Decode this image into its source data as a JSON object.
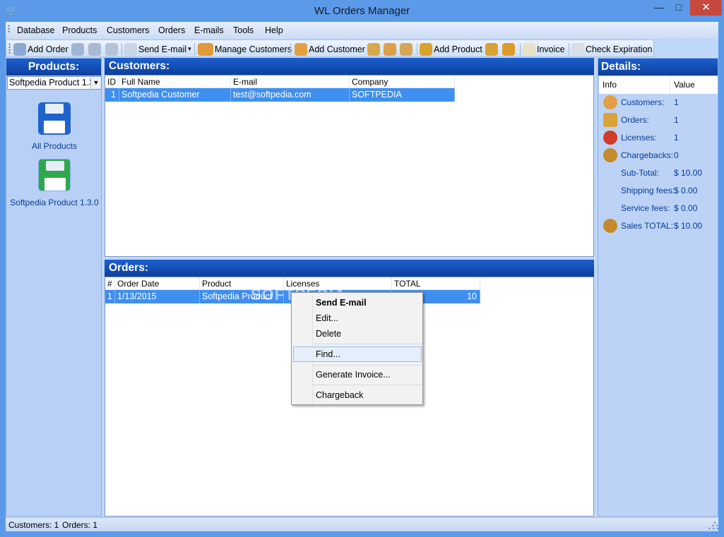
{
  "window": {
    "title": "WL Orders Manager"
  },
  "menu": [
    "Database",
    "Products",
    "Customers",
    "Orders",
    "E-mails",
    "Tools",
    "Help"
  ],
  "toolbar": {
    "add_order": "Add Order",
    "send_email": "Send E-mail",
    "manage_customers": "Manage Customers",
    "add_customer": "Add Customer",
    "add_product": "Add Product",
    "invoice": "Invoice",
    "check_expiration": "Check Expiration",
    "dropdown_arrow": "▾"
  },
  "products": {
    "heading": "Products:",
    "selected": "Softpedia Product 1.3.0",
    "items": [
      {
        "label": "All Products",
        "icon": "floppy-blue-icon",
        "color": "#1f63cc"
      },
      {
        "label": "Softpedia Product 1.3.0",
        "icon": "floppy-green-icon",
        "color": "#2ea84a"
      }
    ]
  },
  "customers": {
    "heading": "Customers:",
    "columns": [
      "ID",
      "Full Name",
      "E-mail",
      "Company"
    ],
    "rows": [
      {
        "id": "1",
        "full_name": "Softpedia Customer",
        "email": "test@softpedia.com",
        "company": "SOFTPEDIA"
      }
    ]
  },
  "orders": {
    "heading": "Orders:",
    "columns": [
      "#",
      "Order Date",
      "Product",
      "Licenses",
      "TOTAL"
    ],
    "rows": [
      {
        "num": "1",
        "order_date": "1/13/2015",
        "product": "Softpedia Product",
        "licenses": "",
        "total": "10"
      }
    ],
    "watermark": "SOFTPEDIA"
  },
  "context_menu": {
    "items": [
      "Send E-mail",
      "Edit...",
      "Delete",
      "Find...",
      "Generate Invoice...",
      "Chargeback"
    ],
    "highlighted": "Find..."
  },
  "details": {
    "heading": "Details:",
    "columns": [
      "Info",
      "Value"
    ],
    "rows": [
      {
        "label": "Customers:",
        "value": "1",
        "icon": "customer-icon"
      },
      {
        "label": "Orders:",
        "value": "1",
        "icon": "orders-box-icon"
      },
      {
        "label": "Licenses:",
        "value": "1",
        "icon": "license-ribbon-icon"
      },
      {
        "label": "Chargebacks:",
        "value": "0",
        "icon": "money-bag-icon"
      },
      {
        "label": "Sub-Total:",
        "value": "$ 10.00"
      },
      {
        "label": "Shipping fees:",
        "value": "$ 0.00"
      },
      {
        "label": "Service fees:",
        "value": "$ 0.00"
      },
      {
        "label": "Sales TOTAL:",
        "value": "$ 10.00",
        "icon": "money-bag-icon"
      }
    ]
  },
  "status": {
    "customers": "Customers: 1",
    "orders": "Orders: 1"
  },
  "colors": {
    "accent": "#0d3f9c",
    "selection": "#3e8ff0",
    "panel": "#b8d0f5"
  }
}
